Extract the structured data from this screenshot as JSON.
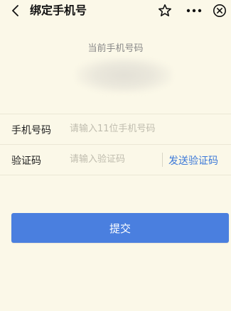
{
  "header": {
    "title": "绑定手机号",
    "icons": [
      "chevron-left-icon",
      "star-icon",
      "more-icon",
      "close-icon"
    ]
  },
  "current": {
    "label": "当前手机号码"
  },
  "form": {
    "phone": {
      "label": "手机号码",
      "placeholder": "请输入11位手机号码"
    },
    "code": {
      "label": "验证码",
      "placeholder": "请输入验证码",
      "send_label": "发送验证码"
    }
  },
  "submit": {
    "label": "提交"
  },
  "colors": {
    "background": "#fbf8e8",
    "accent": "#4a7fdf",
    "link": "#3b78d8"
  }
}
